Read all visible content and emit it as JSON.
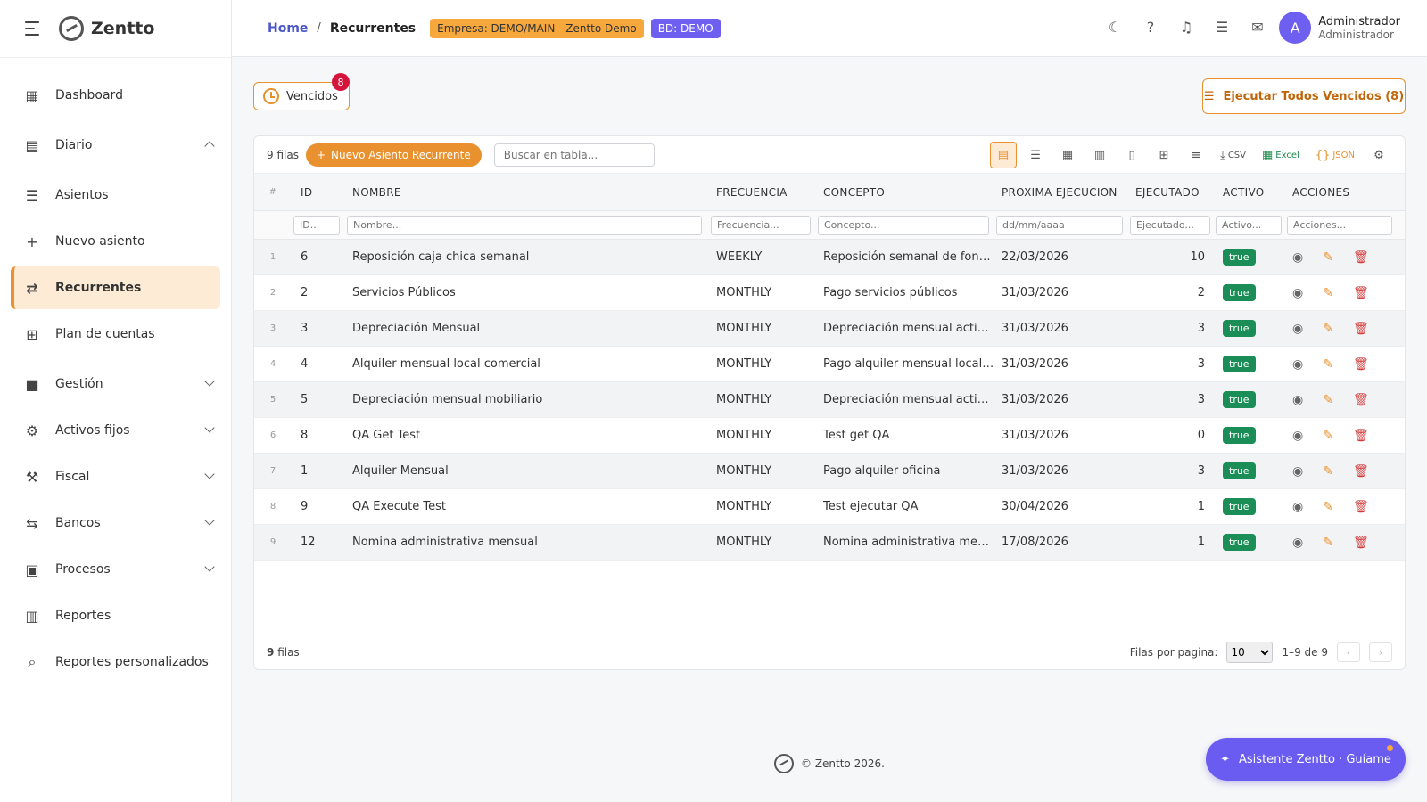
{
  "app": {
    "name": "Zentto"
  },
  "sidebar": {
    "items": [
      {
        "label": "Dashboard",
        "icon": "dashboard-icon",
        "glyph": "▦"
      },
      {
        "label": "Diario",
        "icon": "book-icon",
        "glyph": "▤",
        "expanded": true
      },
      {
        "label": "Asientos",
        "icon": "list-icon",
        "glyph": "☰"
      },
      {
        "label": "Nuevo asiento",
        "icon": "plus-icon",
        "glyph": "+"
      },
      {
        "label": "Recurrentes",
        "icon": "repeat-icon",
        "glyph": "⇄",
        "active": true
      },
      {
        "label": "Plan de cuentas",
        "icon": "tree-icon",
        "glyph": "⊞"
      },
      {
        "label": "Gestión",
        "icon": "briefcase-icon",
        "glyph": "■"
      },
      {
        "label": "Activos fijos",
        "icon": "precision-icon",
        "glyph": "⚙"
      },
      {
        "label": "Fiscal",
        "icon": "gavel-icon",
        "glyph": "⚒"
      },
      {
        "label": "Bancos",
        "icon": "transfer-icon",
        "glyph": "⇆"
      },
      {
        "label": "Procesos",
        "icon": "lock-icon",
        "glyph": "▣"
      },
      {
        "label": "Reportes",
        "icon": "bar-chart-icon",
        "glyph": "▥"
      },
      {
        "label": "Reportes personalizados",
        "icon": "query-stats-icon",
        "glyph": "⌕"
      }
    ]
  },
  "header": {
    "breadcrumb_home": "Home",
    "breadcrumb_sep": "/",
    "breadcrumb_current": "Recurrentes",
    "empresa_badge": "Empresa: DEMO/MAIN - Zentto Demo",
    "bd_badge": "BD: DEMO",
    "icons": [
      {
        "name": "dark-mode-icon",
        "glyph": "☾"
      },
      {
        "name": "help-icon",
        "glyph": "?"
      },
      {
        "name": "bell-icon",
        "glyph": "♫"
      },
      {
        "name": "tasks-icon",
        "glyph": "☰"
      },
      {
        "name": "mail-icon",
        "glyph": "✉"
      }
    ],
    "user_initial": "A",
    "user_name": "Administrador",
    "user_role": "Administrador"
  },
  "actions": {
    "vencidos_label": "Vencidos",
    "vencidos_count": "8",
    "execute_all_label": "Ejecutar Todos Vencidos (8)"
  },
  "grid": {
    "row_count_label": "9 filas",
    "new_button": "Nuevo Asiento Recurrente",
    "search_placeholder": "Buscar en tabla...",
    "csv_label": "CSV",
    "excel_label": "Excel",
    "json_label": "JSON",
    "columns": {
      "idx": "#",
      "id": "ID",
      "nombre": "NOMBRE",
      "frecuencia": "FRECUENCIA",
      "concepto": "CONCEPTO",
      "proxima": "PROXIMA EJECUCION",
      "ejecutado": "EJECUTADO",
      "activo": "ACTIVO",
      "acciones": "ACCIONES"
    },
    "filters": {
      "id": "ID...",
      "nombre": "Nombre...",
      "frecuencia": "Frecuencia...",
      "concepto": "Concepto...",
      "proxima": "dd/mm/aaaa",
      "ejecutado": "Ejecutado...",
      "activo": "Activo...",
      "acciones": "Acciones..."
    },
    "rows": [
      {
        "idx": "1",
        "id": "6",
        "nombre": "Reposición caja chica semanal",
        "frecuencia": "WEEKLY",
        "concepto": "Reposición semanal de fondo de caja chica",
        "proxima": "22/03/2026",
        "ejecutado": "10",
        "activo": "true"
      },
      {
        "idx": "2",
        "id": "2",
        "nombre": "Servicios Públicos",
        "frecuencia": "MONTHLY",
        "concepto": "Pago servicios públicos",
        "proxima": "31/03/2026",
        "ejecutado": "2",
        "activo": "true"
      },
      {
        "idx": "3",
        "id": "3",
        "nombre": "Depreciación Mensual",
        "frecuencia": "MONTHLY",
        "concepto": "Depreciación mensual activos fijos",
        "proxima": "31/03/2026",
        "ejecutado": "3",
        "activo": "true"
      },
      {
        "idx": "4",
        "id": "4",
        "nombre": "Alquiler mensual local comercial",
        "frecuencia": "MONTHLY",
        "concepto": "Pago alquiler mensual local comercial",
        "proxima": "31/03/2026",
        "ejecutado": "3",
        "activo": "true"
      },
      {
        "idx": "5",
        "id": "5",
        "nombre": "Depreciación mensual mobiliario",
        "frecuencia": "MONTHLY",
        "concepto": "Depreciación mensual activos mobiliario",
        "proxima": "31/03/2026",
        "ejecutado": "3",
        "activo": "true"
      },
      {
        "idx": "6",
        "id": "8",
        "nombre": "QA Get Test",
        "frecuencia": "MONTHLY",
        "concepto": "Test get QA",
        "proxima": "31/03/2026",
        "ejecutado": "0",
        "activo": "true"
      },
      {
        "idx": "7",
        "id": "1",
        "nombre": "Alquiler Mensual",
        "frecuencia": "MONTHLY",
        "concepto": "Pago alquiler oficina",
        "proxima": "31/03/2026",
        "ejecutado": "3",
        "activo": "true"
      },
      {
        "idx": "8",
        "id": "9",
        "nombre": "QA Execute Test",
        "frecuencia": "MONTHLY",
        "concepto": "Test ejecutar QA",
        "proxima": "30/04/2026",
        "ejecutado": "1",
        "activo": "true"
      },
      {
        "idx": "9",
        "id": "12",
        "nombre": "Nomina administrativa mensual",
        "frecuencia": "MONTHLY",
        "concepto": "Nomina administrativa mensual personal",
        "proxima": "17/08/2026",
        "ejecutado": "1",
        "activo": "true"
      }
    ],
    "footer_count_num": "9",
    "footer_count_word": "filas",
    "rows_per_page_label": "Filas por pagina:",
    "rows_per_page_value": "10",
    "range_label": "1–9 de 9"
  },
  "footer": {
    "copyright": "© Zentto 2026."
  },
  "assistant": {
    "label": "Asistente Zentto · Guíame"
  },
  "colors": {
    "accent": "#e8912e",
    "primary": "#6a5cf0",
    "success": "#1a8e56",
    "danger": "#d63a3a"
  }
}
